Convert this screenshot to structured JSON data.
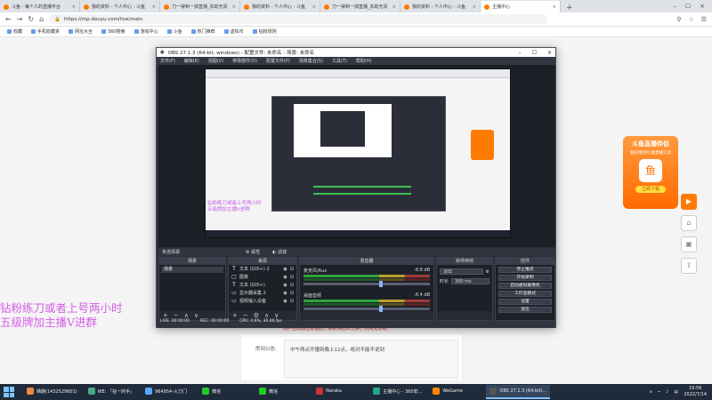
{
  "browser": {
    "tabs": [
      {
        "label": "斗鱼 - 每个人的直播平台"
      },
      {
        "label": "我的资料 - 个人中心 - 斗鱼"
      },
      {
        "label": "刀一得到一掉直播_永劫无间"
      },
      {
        "label": "我的资料 - 个人中心 - 斗鱼"
      },
      {
        "label": "刀一得到一掉直播_永劫无间"
      },
      {
        "label": "我的资料 - 个人中心 - 斗鱼"
      },
      {
        "label": "主播中心"
      }
    ],
    "url": "https://mp.douyu.com/live/main",
    "bookmarks": [
      "收藏",
      "手机收藏夹",
      "网址大全",
      "360搜索",
      "游戏中心",
      "斗鱼",
      "热门推荐",
      "虚拟币",
      "钻粉规则"
    ]
  },
  "obs": {
    "title": "OBS 27.1.3 (64-bit, windows) - 配置文件: 未命名 - 场景: 未命名",
    "menu": [
      "文件(F)",
      "编辑(E)",
      "视图(V)",
      "停靠部件(D)",
      "配置文件(P)",
      "场景集合(S)",
      "工具(T)",
      "帮助(H)"
    ],
    "no_source": "未选择源",
    "props_label": "属性",
    "filters_label": "滤镜",
    "docks": {
      "scenes": {
        "title": "场景",
        "items": [
          "场景"
        ]
      },
      "sources": {
        "title": "来源",
        "items": [
          {
            "icon": "T",
            "label": "文本 (GDI+) 2"
          },
          {
            "icon": "▢",
            "label": "图像"
          },
          {
            "icon": "T",
            "label": "文本 (GDI+)"
          },
          {
            "icon": "▭",
            "label": "显示器采集 2"
          },
          {
            "icon": "▭",
            "label": "视频输入设备"
          }
        ]
      },
      "mixer": {
        "title": "混音器",
        "channels": [
          {
            "name": "麦克风/Aux",
            "db": "-8.8 dB",
            "level": 0.6
          },
          {
            "name": "桌面音频",
            "db": "-8.4 dB",
            "level": 0.6
          }
        ]
      },
      "transitions": {
        "title": "转场特效",
        "type": "淡出",
        "duration_label": "时长",
        "duration": "300 ms"
      },
      "controls": {
        "title": "控件",
        "buttons": [
          "停止推流",
          "开始录制",
          "启动虚拟摄像机",
          "工作室模式",
          "设置",
          "退出"
        ]
      }
    },
    "status": {
      "live": "LIVE: 00:00:00",
      "rec": "REC: 00:00:00",
      "cpu": "CPU: 4.6%, 30.00 fps"
    }
  },
  "overlay": {
    "line1": "钻粉练刀或者上号两小时",
    "line2": "五级牌加主播V进群",
    "nested_line1": "钻粉练刀或者上号两小时",
    "nested_line2": "五级牌加主播V进群"
  },
  "page": {
    "promo": {
      "title": "斗鱼直播伴侣",
      "subtitle": "超好用的PC端直播工具",
      "button": "立即下载"
    },
    "notice_label": "房间公告:",
    "notice_text": "中午两点开播到晚上12点，绝对不能不说到",
    "red_line": "用户自动通过举报后，将被冻结10分钟，时间无限制。"
  },
  "taskbar": {
    "items": [
      {
        "label": "晴朗(1432529601)",
        "color": "#e84"
      },
      {
        "label": "WE: 「钻一的手」",
        "color": "#4a8"
      },
      {
        "label": "964954-火刀门",
        "color": "#5af"
      },
      {
        "label": "微信",
        "color": "#2c2"
      },
      {
        "label": "微信",
        "color": "#2c2"
      },
      {
        "label": "Naraka",
        "color": "#c33"
      },
      {
        "label": "主播中心 - 360安...",
        "color": "#2a8"
      },
      {
        "label": "WeGame",
        "color": "#f80"
      },
      {
        "label": "OBS 27.1.3 (64-bit)...",
        "color": "#555"
      }
    ],
    "time": "19:56",
    "date": "2022/7/14"
  }
}
